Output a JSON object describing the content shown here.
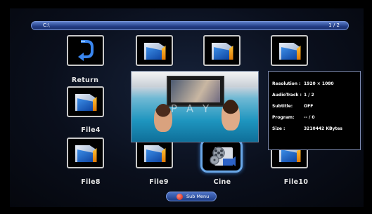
{
  "path_bar": {
    "path": "C:\\",
    "page": "1 / 2"
  },
  "items": [
    {
      "label": "Return",
      "icon": "return-arrow-icon"
    },
    {
      "label": "",
      "icon": "folder-icon"
    },
    {
      "label": "",
      "icon": "folder-icon"
    },
    {
      "label": "",
      "icon": "folder-icon"
    },
    {
      "label": "File4",
      "icon": "folder-icon"
    },
    {
      "label": "File8",
      "icon": "folder-icon"
    },
    {
      "label": "File9",
      "icon": "folder-icon"
    },
    {
      "label": "Cine",
      "icon": "video-file-icon",
      "selected": true
    },
    {
      "label": "File10",
      "icon": "folder-icon"
    }
  ],
  "preview": {
    "overlay_text": "PAY"
  },
  "info": {
    "resolution_label": "Resolution :",
    "resolution_value": "1920 × 1080",
    "audiotrack_label": "AudioTrack :",
    "audiotrack_value": "1 / 2",
    "subtitle_label": "Subtitle:",
    "subtitle_value": "OFF",
    "program_label": "Program:",
    "program_value": "-- / 0",
    "size_label": "Size :",
    "size_value": "3210442 KBytes"
  },
  "submenu": {
    "label": "Sub Menu"
  },
  "colors": {
    "accent": "#233d86",
    "selection": "#6aa8e8"
  }
}
